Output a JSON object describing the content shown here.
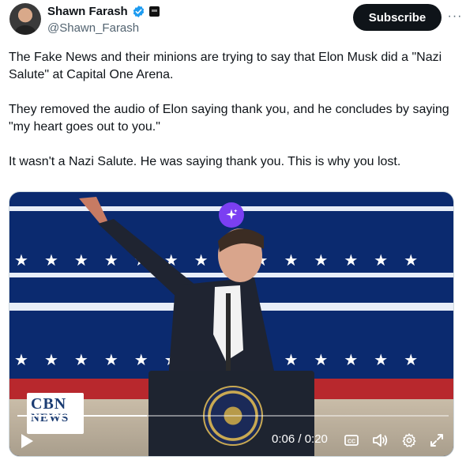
{
  "author": {
    "display_name": "Shawn Farash",
    "handle": "@Shawn_Farash"
  },
  "actions": {
    "subscribe_label": "Subscribe",
    "more_label": "···"
  },
  "tweet": {
    "paragraphs": [
      "The Fake News and their minions are trying to say that Elon Musk did a \"Nazi Salute\" at Capital One Arena.",
      "They removed the audio of Elon saying thank you, and he concludes by saying \"my heart goes out to you.\"",
      "It wasn't a Nazi Salute. He was saying thank you. This is why you lost."
    ]
  },
  "video": {
    "time_display": "0:06 / 0:20",
    "progress_fraction": 0.3,
    "watermark_top": "CBN",
    "watermark_bottom": "NEWS"
  },
  "colors": {
    "brand_blue": "#1d9bf0",
    "subscribe_bg": "#0f1419",
    "grok_purple": "#7b3ff2"
  },
  "icons": {
    "verified": "verified-badge-icon",
    "affiliate": "affiliate-badge-icon",
    "grok": "sparkle-icon",
    "play": "play-icon",
    "captions": "captions-icon",
    "volume": "volume-icon",
    "settings": "gear-icon",
    "fullscreen": "fullscreen-icon"
  }
}
